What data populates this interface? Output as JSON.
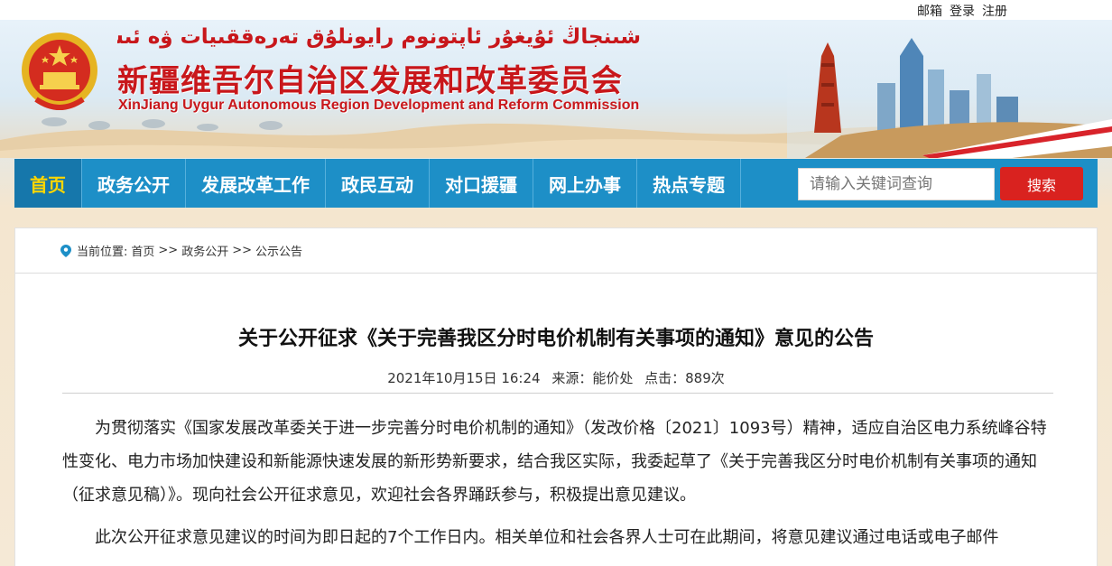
{
  "topbar": {
    "mail": "邮箱",
    "login": "登录",
    "register": "注册"
  },
  "header": {
    "title_uyghur": "شىنجاڭ ئۇيغۇر ئاپتونوم رايونلۇق تەرەققىيات ۋە ئىسلاھات كومىتېتى",
    "title_cn": "新疆维吾尔自治区发展和改革委员会",
    "title_en": "XinJiang Uygur Autonomous Region Development and Reform Commission",
    "emblem_icon": "national-emblem-icon"
  },
  "nav": {
    "items": [
      {
        "label": "首页",
        "active": true
      },
      {
        "label": "政务公开",
        "active": false
      },
      {
        "label": "发展改革工作",
        "active": false
      },
      {
        "label": "政民互动",
        "active": false
      },
      {
        "label": "对口援疆",
        "active": false
      },
      {
        "label": "网上办事",
        "active": false
      },
      {
        "label": "热点专题",
        "active": false
      }
    ],
    "search_placeholder": "请输入关键词查询",
    "search_button": "搜索"
  },
  "breadcrumb": {
    "prefix": "当前位置:",
    "items": [
      "首页",
      "政务公开",
      "公示公告"
    ],
    "separator": ">>"
  },
  "article": {
    "title": "关于公开征求《关于完善我区分时电价机制有关事项的通知》意见的公告",
    "date": "2021年10月15日 16:24",
    "source": "来源：能价处",
    "clicks": "点击：889次",
    "paragraphs": [
      "为贯彻落实《国家发展改革委关于进一步完善分时电价机制的通知》（发改价格〔2021〕1093号）精神，适应自治区电力系统峰谷特性变化、电力市场加快建设和新能源快速发展的新形势新要求，结合我区实际，我委起草了《关于完善我区分时电价机制有关事项的通知（征求意见稿）》。现向社会公开征求意见，欢迎社会各界踊跃参与，积极提出意见建议。",
      "此次公开征求意见建议的时间为即日起的7个工作日内。相关单位和社会各界人士可在此期间，将意见建议通过电话或电子邮件"
    ]
  },
  "colors": {
    "nav_bg": "#1d8fc7",
    "nav_active_bg": "#1677ab",
    "nav_active_text": "#ffd600",
    "brand_red": "#c8171b",
    "search_button_bg": "#d9221f"
  }
}
